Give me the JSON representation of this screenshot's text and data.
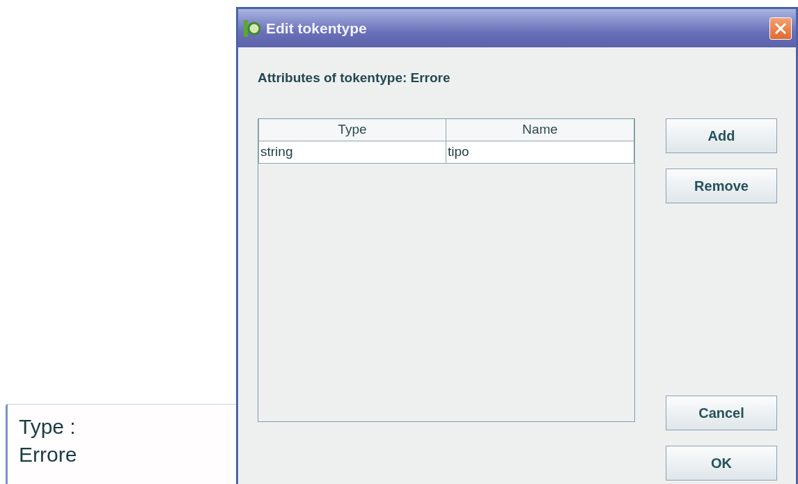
{
  "side_panel": {
    "lines": [
      "Type :",
      "Errore"
    ]
  },
  "window": {
    "title": "Edit tokentype"
  },
  "heading": "Attributes of tokentype: Errore",
  "table": {
    "columns": [
      "Type",
      "Name"
    ],
    "rows": [
      [
        "string",
        "tipo"
      ]
    ]
  },
  "buttons": [
    "Add",
    "Remove"
  ],
  "footer_buttons": [
    "Cancel",
    "OK"
  ]
}
